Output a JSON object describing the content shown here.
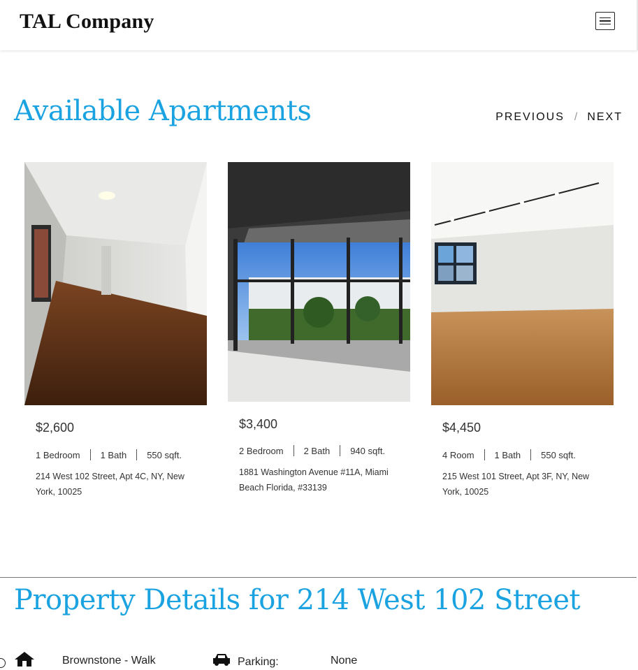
{
  "header": {
    "logo": "TAL Company",
    "menu_icon": "hamburger-menu-icon"
  },
  "section": {
    "title": "Available Apartments",
    "prev_label": "PREVIOUS",
    "separator": "/",
    "next_label": "NEXT"
  },
  "listings": [
    {
      "price": "$2,600",
      "rooms": "1 Bedroom",
      "baths": "1 Bath",
      "size": "550 sqft.",
      "address": "214 West 102 Street, Apt 4C, NY, New York, 10025"
    },
    {
      "price": "$3,400",
      "rooms": "2 Bedroom",
      "baths": "2 Bath",
      "size": "940 sqft.",
      "address": "1881 Washington Avenue #11A, Miami Beach Florida, #33139"
    },
    {
      "price": "$4,450",
      "rooms": "4 Room",
      "baths": "1 Bath",
      "size": "550 sqft.",
      "address": "215 West 101 Street, Apt 3F, NY, New York, 10025"
    }
  ],
  "details": {
    "title": "Property Details for 214 West 102 Street",
    "type_icon": "house-icon",
    "type_value": "Brownstone - Walk",
    "parking_icon": "car-icon",
    "parking_label": "Parking:",
    "parking_value": "None"
  },
  "colors": {
    "accent": "#1aa3e0"
  }
}
